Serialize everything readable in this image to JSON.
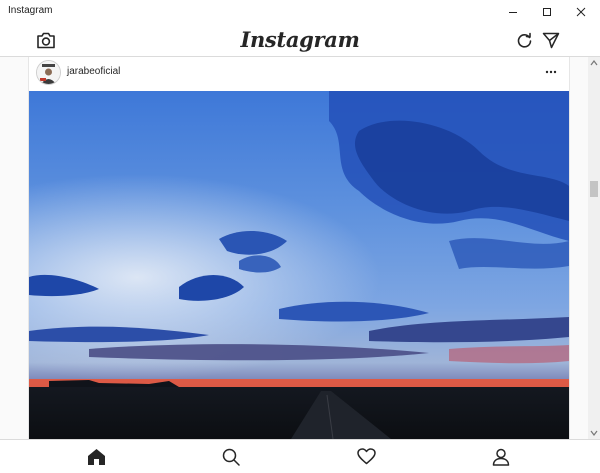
{
  "window": {
    "title": "Instagram"
  },
  "header": {
    "logo": "Instagram"
  },
  "post": {
    "username": "jarabeoficial"
  },
  "icons": {
    "camera": "camera-icon",
    "refresh": "refresh-icon",
    "direct": "direct-message-icon",
    "more": "more-options-icon",
    "home": "home-icon",
    "search": "search-icon",
    "activity": "heart-icon",
    "profile": "profile-icon"
  },
  "colors": {
    "text": "#262626",
    "border": "#dbdbdb",
    "background": "#fafafa"
  }
}
